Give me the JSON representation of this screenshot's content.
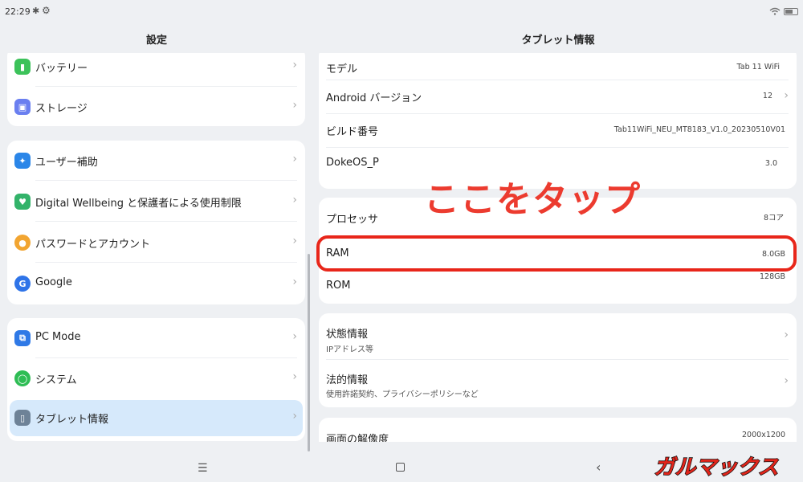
{
  "status": {
    "time": "22:29"
  },
  "left": {
    "title": "設定",
    "items": [
      {
        "label": "バッテリー"
      },
      {
        "label": "ストレージ"
      },
      {
        "label": "ユーザー補助"
      },
      {
        "label": "Digital Wellbeing と保護者による使用制限"
      },
      {
        "label": "パスワードとアカウント"
      },
      {
        "label": "Google"
      },
      {
        "label": "PC Mode"
      },
      {
        "label": "システム"
      },
      {
        "label": "タブレット情報"
      }
    ]
  },
  "right": {
    "title": "タブレット情報",
    "rows": [
      {
        "label": "モデル",
        "value": "Tab 11 WiFi"
      },
      {
        "label": "Android バージョン",
        "value": "12"
      },
      {
        "label": "ビルド番号",
        "value": "Tab11WiFi_NEU_MT8183_V1.0_20230510V01"
      },
      {
        "label": "DokeOS_P",
        "value": "3.0"
      },
      {
        "label": "プロセッサ",
        "value": "8コア"
      },
      {
        "label": "RAM",
        "value": "8.0GB"
      },
      {
        "label": "ROM",
        "value": "128GB"
      },
      {
        "label": "状態情報",
        "sub": "IPアドレス等"
      },
      {
        "label": "法的情報",
        "sub": "使用許諾契約、プライバシーポリシーなど"
      },
      {
        "label": "画面の解像度",
        "value": "2000x1200"
      }
    ]
  },
  "annotation": {
    "text": "ここをタップ",
    "color": "#ec3b2f"
  },
  "watermark": {
    "text": "ガルマックス"
  },
  "icons": [
    "bluetooth-icon",
    "gear-icon",
    "wifi-icon",
    "battery-icon",
    "battery-app-icon",
    "storage-icon",
    "accessibility-icon",
    "wellbeing-icon",
    "account-icon",
    "google-icon",
    "pc-mode-icon",
    "system-icon",
    "tablet-info-icon",
    "menu-icon",
    "home-icon",
    "back-icon"
  ]
}
